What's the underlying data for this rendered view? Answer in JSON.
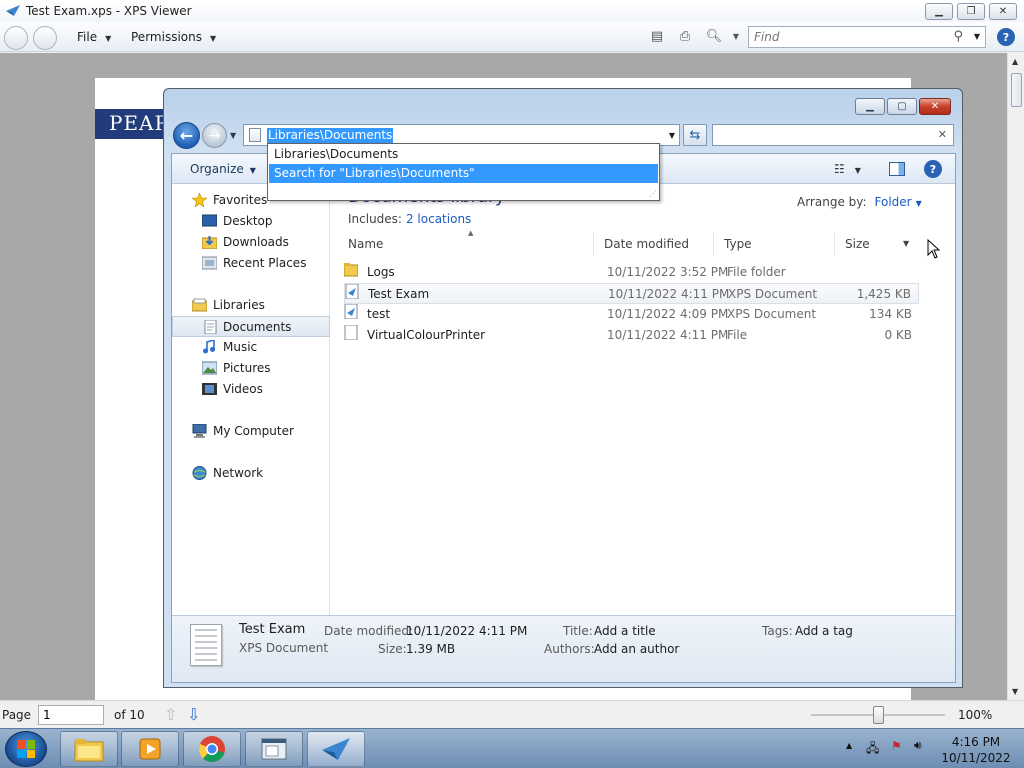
{
  "xps": {
    "window_title": "Test Exam.xps - XPS Viewer",
    "menus": {
      "file": "File",
      "permissions": "Permissions"
    },
    "find_placeholder": "Find",
    "logo_text": "PEAR",
    "status": {
      "page_label": "Page",
      "page_value": "1",
      "page_of": "of 10",
      "zoom": "100%"
    }
  },
  "dialog": {
    "address": "Libraries\\Documents",
    "toolbar": {
      "organize": "Organize"
    },
    "autocomplete": [
      "Libraries\\Documents",
      "Search for \"Libraries\\Documents\""
    ],
    "nav": {
      "favorites": "Favorites",
      "desktop": "Desktop",
      "downloads": "Downloads",
      "recent_places": "Recent Places",
      "libraries": "Libraries",
      "documents": "Documents",
      "music": "Music",
      "pictures": "Pictures",
      "videos": "Videos",
      "computer": "My Computer",
      "network": "Network"
    },
    "library": {
      "title": "Documents library",
      "includes_label": "Includes:",
      "includes_link": "2 locations",
      "arrange_label": "Arrange by:",
      "arrange_value": "Folder"
    },
    "columns": {
      "name": "Name",
      "date": "Date modified",
      "type": "Type",
      "size": "Size"
    },
    "files": [
      {
        "name": "Logs",
        "date": "10/11/2022 3:52 PM",
        "type": "File folder",
        "size": ""
      },
      {
        "name": "Test Exam",
        "date": "10/11/2022 4:11 PM",
        "type": "XPS Document",
        "size": "1,425 KB"
      },
      {
        "name": "test",
        "date": "10/11/2022 4:09 PM",
        "type": "XPS Document",
        "size": "134 KB"
      },
      {
        "name": "VirtualColourPrinter",
        "date": "10/11/2022 4:11 PM",
        "type": "File",
        "size": "0 KB"
      }
    ],
    "details": {
      "name": "Test Exam",
      "kind": "XPS Document",
      "date_label": "Date modified:",
      "date_value": "10/11/2022 4:11 PM",
      "size_label": "Size:",
      "size_value": "1.39 MB",
      "title_label": "Title:",
      "title_value": "Add a title",
      "authors_label": "Authors:",
      "authors_value": "Add an author",
      "tags_label": "Tags:",
      "tags_value": "Add a tag"
    }
  },
  "taskbar": {
    "clock_time": "4:16 PM",
    "clock_date": "10/11/2022",
    "apps": [
      "windows-explorer",
      "media-player",
      "chrome",
      "xps-document",
      "xps-viewer"
    ]
  }
}
